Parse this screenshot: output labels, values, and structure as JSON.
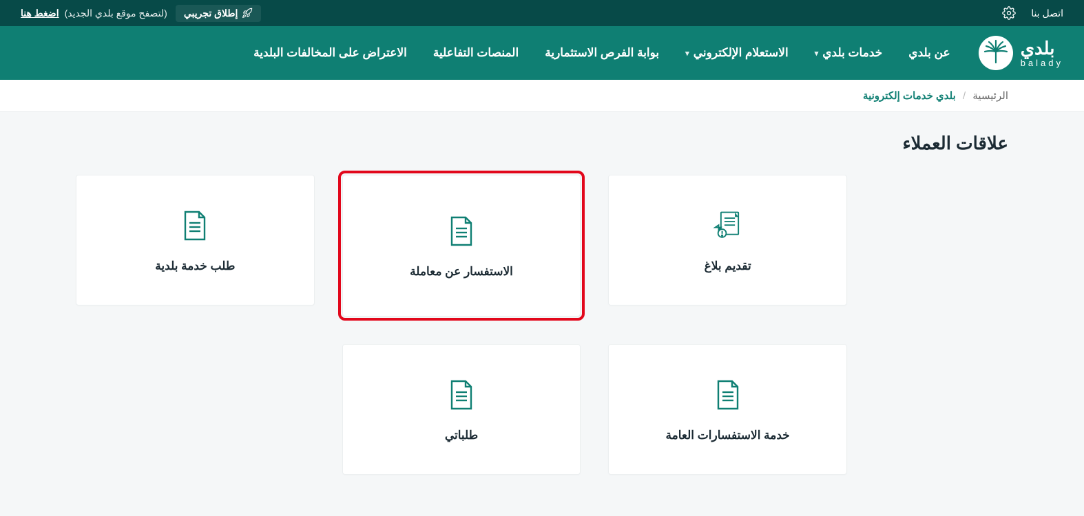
{
  "topbar": {
    "contact": "اتصل بنا",
    "trial_badge": "إطلاق تجريبي",
    "trial_sub": "(لتصفح موقع بلدي الجديد)",
    "trial_link": "اضغط هنا"
  },
  "brand": {
    "ar": "بلدي",
    "en": "balady"
  },
  "nav": {
    "about": "عن بلدي",
    "services": "خدمات بلدي",
    "inquiry": "الاستعلام الإلكتروني",
    "invest": "بوابة الفرص الاستثمارية",
    "platforms": "المنصات التفاعلية",
    "objection": "الاعتراض على المخالفات البلدية"
  },
  "breadcrumb": {
    "home": "الرئيسية",
    "current": "بلدي خدمات إلكترونية"
  },
  "page": {
    "title": "علاقات العملاء"
  },
  "cards": {
    "c1": "تقديم  بلاغ",
    "c2": "الاستفسار عن معاملة",
    "c3": "طلب خدمة بلدية",
    "c4": "خدمة الاستفسارات العامة",
    "c5": "طلباتي"
  }
}
